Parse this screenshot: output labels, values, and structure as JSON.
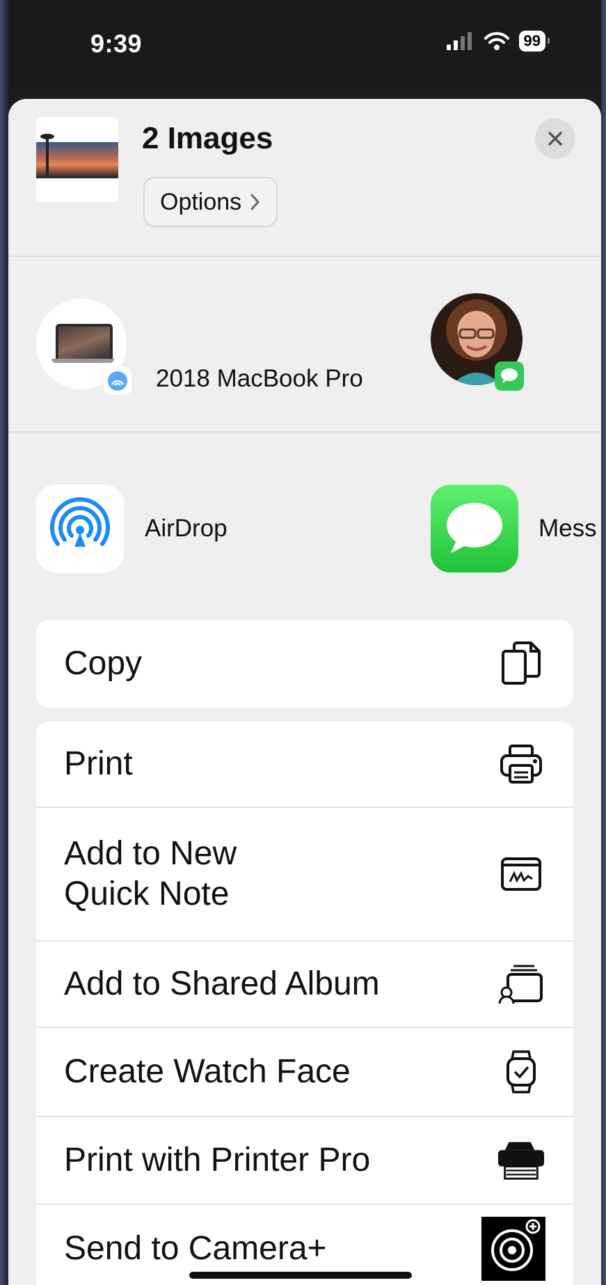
{
  "status_bar": {
    "time": "9:39",
    "battery": "99"
  },
  "share_sheet": {
    "title": "2 Images",
    "options_label": "Options",
    "people": [
      {
        "name": "2018 MacBook Pro",
        "badge": "airdrop-icon"
      },
      {
        "name": "",
        "badge": "messages-icon"
      }
    ],
    "apps": [
      {
        "name": "AirDrop",
        "icon": "airdrop-icon"
      },
      {
        "name": "Mess",
        "icon": "messages-icon"
      }
    ],
    "actions_group1": [
      {
        "label": "Copy",
        "icon": "copy-icon"
      }
    ],
    "actions_group2": [
      {
        "label": "Print",
        "icon": "printer-icon"
      },
      {
        "label": "Add to New\nQuick Note",
        "icon": "quick-note-icon"
      },
      {
        "label": "Add to Shared Album",
        "icon": "shared-album-icon"
      },
      {
        "label": "Create Watch Face",
        "icon": "watch-icon"
      },
      {
        "label": "Print with Printer Pro",
        "icon": "printer-pro-icon"
      },
      {
        "label": "Send to Camera+",
        "icon": "camera-plus-icon"
      }
    ]
  },
  "colors": {
    "accent": "#1c8af7",
    "messages_green": "#34c759",
    "sheet_bg": "#efefef"
  }
}
